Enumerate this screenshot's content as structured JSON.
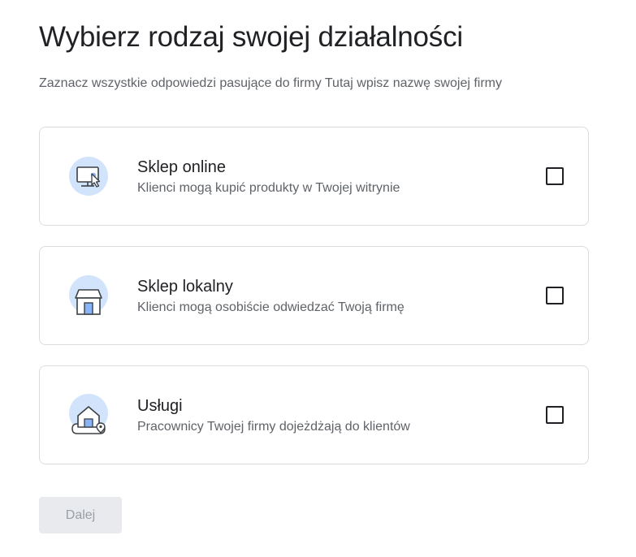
{
  "header": {
    "title": "Wybierz rodzaj swojej działalności",
    "subtitle": "Zaznacz wszystkie odpowiedzi pasujące do firmy Tutaj wpisz nazwę swojej firmy"
  },
  "options": [
    {
      "icon": "online-store-icon",
      "title": "Sklep online",
      "description": "Klienci mogą kupić produkty w Twojej witrynie",
      "checked": false
    },
    {
      "icon": "local-store-icon",
      "title": "Sklep lokalny",
      "description": "Klienci mogą osobiście odwiedzać Twoją firmę",
      "checked": false
    },
    {
      "icon": "service-area-icon",
      "title": "Usługi",
      "description": "Pracownicy Twojej firmy dojeżdżają do klientów",
      "checked": false
    }
  ],
  "footer": {
    "next_label": "Dalej",
    "next_enabled": false
  },
  "colors": {
    "icon_circle": "#d2e3fc",
    "icon_accent": "#8ab4f8",
    "icon_stroke": "#3c4043",
    "border": "#dadce0",
    "button_disabled_bg": "#e8eaed",
    "button_disabled_text": "#9aa0a6"
  }
}
